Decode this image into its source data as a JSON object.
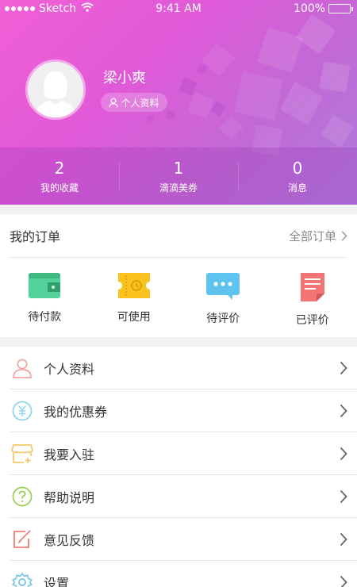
{
  "status_bar": {
    "carrier": "Sketch",
    "time": "9:41 AM",
    "battery": "100%"
  },
  "profile": {
    "name": "梁小爽",
    "profile_link": "个人资料"
  },
  "stats": [
    {
      "value": "2",
      "label": "我的收藏"
    },
    {
      "value": "1",
      "label": "滴滴美券"
    },
    {
      "value": "0",
      "label": "消息"
    }
  ],
  "orders": {
    "title": "我的订单",
    "all_label": "全部订单",
    "items": [
      {
        "label": "待付款",
        "icon": "wallet-icon",
        "color": "#52d19b"
      },
      {
        "label": "可使用",
        "icon": "ticket-icon",
        "color": "#f9c11b"
      },
      {
        "label": "待评价",
        "icon": "comment-icon",
        "color": "#5ec3ef"
      },
      {
        "label": "已评价",
        "icon": "document-icon",
        "color": "#f47474"
      }
    ]
  },
  "menu": [
    {
      "label": "个人资料",
      "icon": "user-icon",
      "color": "#f3a8a8"
    },
    {
      "label": "我的优惠券",
      "icon": "coupon-icon",
      "color": "#8fd7ee"
    },
    {
      "label": "我要入驻",
      "icon": "store-icon",
      "color": "#f5c86a"
    },
    {
      "label": "帮助说明",
      "icon": "help-icon",
      "color": "#9ccf57"
    },
    {
      "label": "意见反馈",
      "icon": "feedback-icon",
      "color": "#f27a7a"
    },
    {
      "label": "设置",
      "icon": "settings-icon",
      "color": "#76c5e8"
    }
  ],
  "colors": {
    "header_gradient_start": "#f260d6",
    "header_gradient_end": "#b07bdc"
  }
}
